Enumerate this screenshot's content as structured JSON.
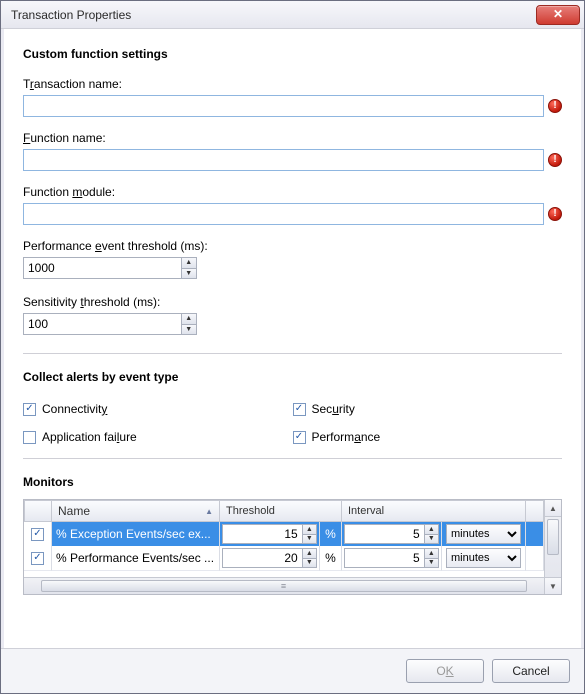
{
  "window": {
    "title": "Transaction Properties"
  },
  "sections": {
    "custom": {
      "heading": "Custom function settings",
      "transaction_name": {
        "label_pre": "T",
        "label_u": "r",
        "label_post": "ansaction name:",
        "value": ""
      },
      "function_name": {
        "label_pre": "",
        "label_u": "F",
        "label_post": "unction name:",
        "value": ""
      },
      "function_module": {
        "label_pre": "Function ",
        "label_u": "m",
        "label_post": "odule:",
        "value": ""
      },
      "perf_threshold": {
        "label_pre": "Performance ",
        "label_u": "e",
        "label_post": "vent threshold (ms):",
        "value": "1000"
      },
      "sens_threshold": {
        "label_pre": "Sensitivity ",
        "label_u": "t",
        "label_post": "hreshold (ms):",
        "value": "100"
      }
    },
    "alerts": {
      "heading": "Collect alerts by event type",
      "connectivity": {
        "label_pre": "Connectivit",
        "label_u": "y",
        "label_post": "",
        "checked": true
      },
      "security": {
        "label_pre": "Sec",
        "label_u": "u",
        "label_post": "rity",
        "checked": true
      },
      "app_failure": {
        "label_pre": "Application fai",
        "label_u": "l",
        "label_post": "ure",
        "checked": false
      },
      "performance": {
        "label_pre": "Perform",
        "label_u": "a",
        "label_post": "nce",
        "checked": true
      }
    },
    "monitors": {
      "heading": "Monitors",
      "columns": {
        "name": "Name",
        "threshold": "Threshold",
        "interval": "Interval"
      },
      "unit_sym": "%",
      "rows": [
        {
          "checked": true,
          "name": "% Exception Events/sec ex...",
          "threshold": "15",
          "interval": "5",
          "interval_unit": "minutes",
          "selected": true
        },
        {
          "checked": true,
          "name": "% Performance Events/sec ...",
          "threshold": "20",
          "interval": "5",
          "interval_unit": "minutes",
          "selected": false
        }
      ]
    }
  },
  "footer": {
    "ok_pre": "O",
    "ok_u": "K",
    "cancel": "Cancel",
    "ok_enabled": false
  }
}
